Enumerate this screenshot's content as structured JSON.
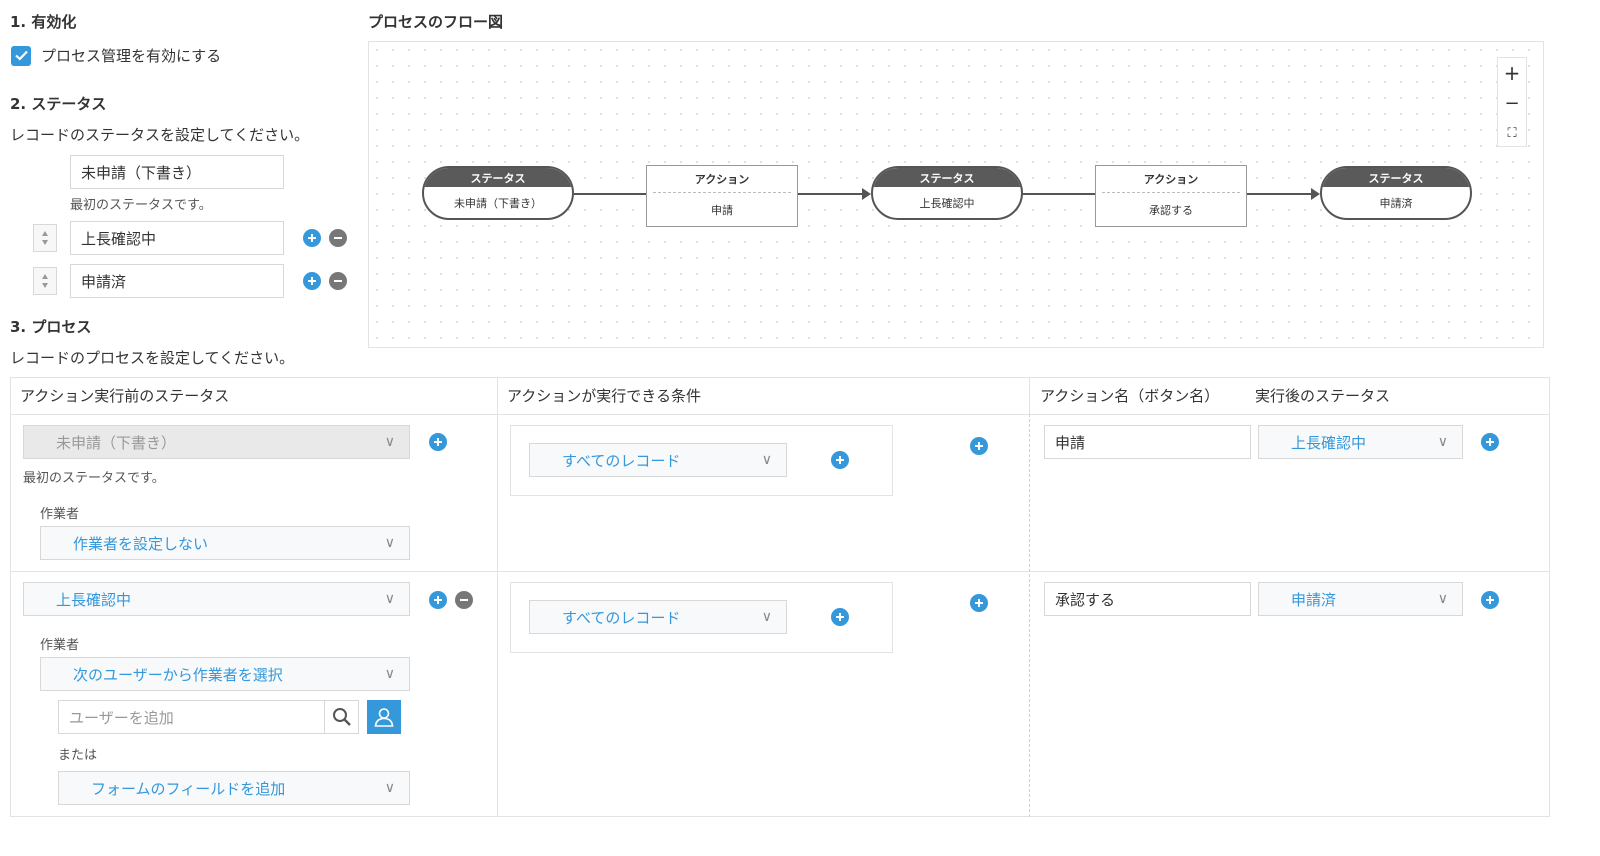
{
  "sec1": {
    "title": "1. 有効化",
    "checkbox_label": "プロセス管理を有効にする"
  },
  "sec2": {
    "title": "2. ステータス",
    "desc": "レコードのステータスを設定してください。",
    "statuses": [
      "未申請（下書き）",
      "上長確認中",
      "申請済"
    ],
    "first_note": "最初のステータスです。"
  },
  "sec3": {
    "title": "3. プロセス",
    "desc": "レコードのプロセスを設定してください。"
  },
  "flow": {
    "title": "プロセスのフロー図",
    "status_head": "ステータス",
    "action_head": "アクション",
    "nodes": [
      "未申請（下書き）",
      "申請",
      "上長確認中",
      "承認する",
      "申請済"
    ],
    "zoom": {
      "plus": "+",
      "minus": "−",
      "fit": "⛶"
    }
  },
  "table": {
    "headers": [
      "アクション実行前のステータス",
      "アクションが実行できる条件",
      "アクション名（ボタン名）",
      "実行後のステータス"
    ],
    "row1": {
      "before": "未申請（下書き）",
      "first_note": "最初のステータスです。",
      "assignee_label": "作業者",
      "assignee": "作業者を設定しない",
      "condition": "すべてのレコード",
      "action_name": "申請",
      "after": "上長確認中"
    },
    "row2": {
      "before": "上長確認中",
      "assignee_label": "作業者",
      "assignee": "次のユーザーから作業者を選択",
      "user_placeholder": "ユーザーを追加",
      "or": "または",
      "field_select": "フォームのフィールドを追加",
      "condition": "すべてのレコード",
      "action_name": "承認する",
      "after": "申請済"
    },
    "chevron": "∨"
  },
  "colors": {
    "accent": "#3498db",
    "node_dark": "#5a5a5a"
  }
}
